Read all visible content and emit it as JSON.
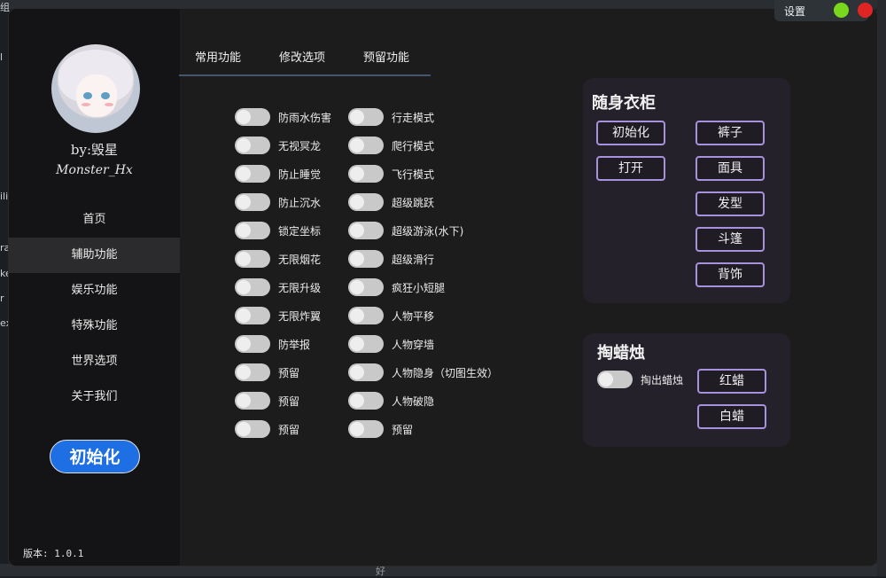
{
  "background": {
    "left_fragments": [
      "组",
      "l",
      "ili",
      "ra",
      "ke",
      "r",
      "ex"
    ],
    "bottom_text": "好"
  },
  "window": {
    "settings": {
      "label": "设置",
      "green_color": "#7ad81c",
      "red_color": "#e02424"
    }
  },
  "sidebar": {
    "author_by": "by:毁星",
    "author_name": "Monster_Hx",
    "nav": [
      {
        "label": "首页"
      },
      {
        "label": "辅助功能"
      },
      {
        "label": "娱乐功能"
      },
      {
        "label": "特殊功能"
      },
      {
        "label": "世界选项"
      },
      {
        "label": "关于我们"
      }
    ],
    "active_nav": "辅助功能",
    "init_button": "初始化",
    "version": "版本: 1.0.1",
    "accent_color": "#1d6fe3"
  },
  "tabs": [
    {
      "label": "常用功能"
    },
    {
      "label": "修改选项"
    },
    {
      "label": "预留功能"
    }
  ],
  "toggles_col1": [
    {
      "label": "防雨水伤害",
      "on": false
    },
    {
      "label": "无视冥龙",
      "on": false
    },
    {
      "label": "防止睡觉",
      "on": false
    },
    {
      "label": "防止沉水",
      "on": false
    },
    {
      "label": "锁定坐标",
      "on": false
    },
    {
      "label": "无限烟花",
      "on": false
    },
    {
      "label": "无限升级",
      "on": false
    },
    {
      "label": "无限炸翼",
      "on": false
    },
    {
      "label": "防举报",
      "on": false
    },
    {
      "label": "预留",
      "on": false
    },
    {
      "label": "预留",
      "on": false
    },
    {
      "label": "预留",
      "on": false
    }
  ],
  "toggles_col2": [
    {
      "label": "行走模式",
      "on": false
    },
    {
      "label": "爬行模式",
      "on": false
    },
    {
      "label": "飞行模式",
      "on": false
    },
    {
      "label": "超级跳跃",
      "on": false
    },
    {
      "label": "超级游泳(水下)",
      "on": false
    },
    {
      "label": "超级滑行",
      "on": false
    },
    {
      "label": "疯狂小短腿",
      "on": false
    },
    {
      "label": "人物平移",
      "on": false
    },
    {
      "label": "人物穿墙",
      "on": false
    },
    {
      "label": "人物隐身（切图生效）",
      "on": false
    },
    {
      "label": "人物破隐",
      "on": false
    },
    {
      "label": "预留",
      "on": false
    }
  ],
  "wardrobe": {
    "title": "随身衣柜",
    "left_buttons": [
      {
        "label": "初始化"
      },
      {
        "label": "打开"
      }
    ],
    "right_buttons": [
      {
        "label": "裤子"
      },
      {
        "label": "面具"
      },
      {
        "label": "发型"
      },
      {
        "label": "斗篷"
      },
      {
        "label": "背饰"
      }
    ],
    "border_color": "#a792e0"
  },
  "candle": {
    "title": "掏蜡烛",
    "toggle_label": "掏出蜡烛",
    "toggle_on": false,
    "buttons": [
      {
        "label": "红蜡"
      },
      {
        "label": "白蜡"
      }
    ]
  }
}
